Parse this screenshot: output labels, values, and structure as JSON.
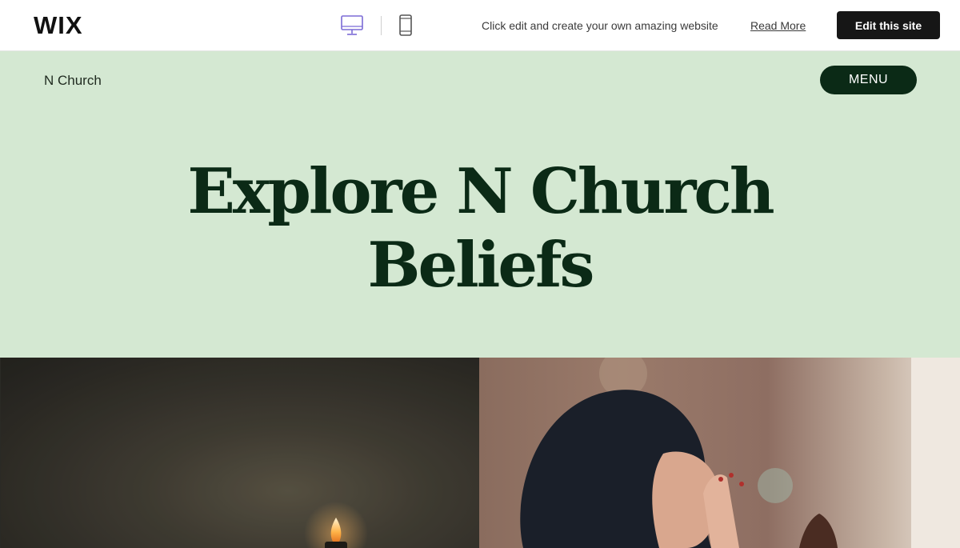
{
  "wixbar": {
    "logo": "WIX",
    "devices": [
      "desktop-icon",
      "mobile-icon"
    ],
    "promo_text": "Click edit and create your own amazing website",
    "read_more": "Read More",
    "edit_button": "Edit this site"
  },
  "site": {
    "name": "N Church",
    "menu_label": "MENU"
  },
  "hero": {
    "title_line1": "Explore N Church",
    "title_line2": "Beliefs"
  },
  "colors": {
    "hero_bg": "#d4e8d2",
    "accent_dark_green": "#0b2a16",
    "edit_button_bg": "#161616",
    "active_device": "#7b6bd6"
  },
  "images": {
    "left": "candle-photo",
    "right": "praying-woman-photo"
  }
}
